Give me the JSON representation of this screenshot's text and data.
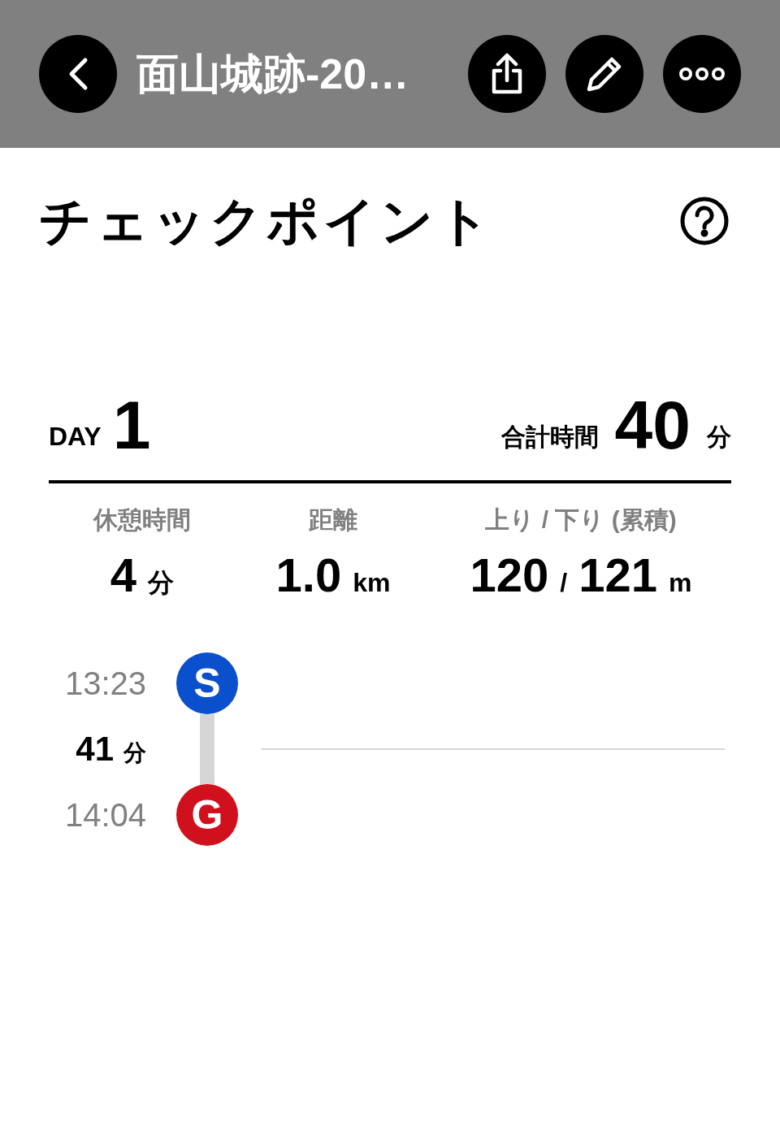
{
  "header": {
    "title": "面山城跡-20…",
    "actions": [
      {
        "kind": "share"
      },
      {
        "kind": "edit"
      },
      {
        "kind": "more"
      }
    ]
  },
  "page_title": "チェックポイント",
  "day": {
    "label": "DAY",
    "number": "1"
  },
  "total": {
    "label": "合計時間",
    "value": "40",
    "unit": "分"
  },
  "stats": [
    {
      "label": "休憩時間",
      "parts": [
        {
          "kind": "value",
          "text": "4"
        },
        {
          "kind": "unit",
          "text": "分"
        }
      ]
    },
    {
      "label": "距離",
      "parts": [
        {
          "kind": "value",
          "text": "1.0"
        },
        {
          "kind": "unit",
          "text": "km"
        }
      ]
    },
    {
      "label": "上り / 下り (累積)",
      "parts": [
        {
          "kind": "value",
          "text": "120"
        },
        {
          "kind": "sep",
          "text": "/"
        },
        {
          "kind": "value",
          "text": "121"
        },
        {
          "kind": "unit",
          "text": "m"
        }
      ]
    }
  ],
  "timeline": [
    {
      "kind": "point",
      "time": "13:23",
      "marker": "S",
      "color": "#0a50cc"
    },
    {
      "kind": "segment",
      "value": "41",
      "unit": "分"
    },
    {
      "kind": "point",
      "time": "14:04",
      "marker": "G",
      "color": "#d0101c"
    }
  ]
}
